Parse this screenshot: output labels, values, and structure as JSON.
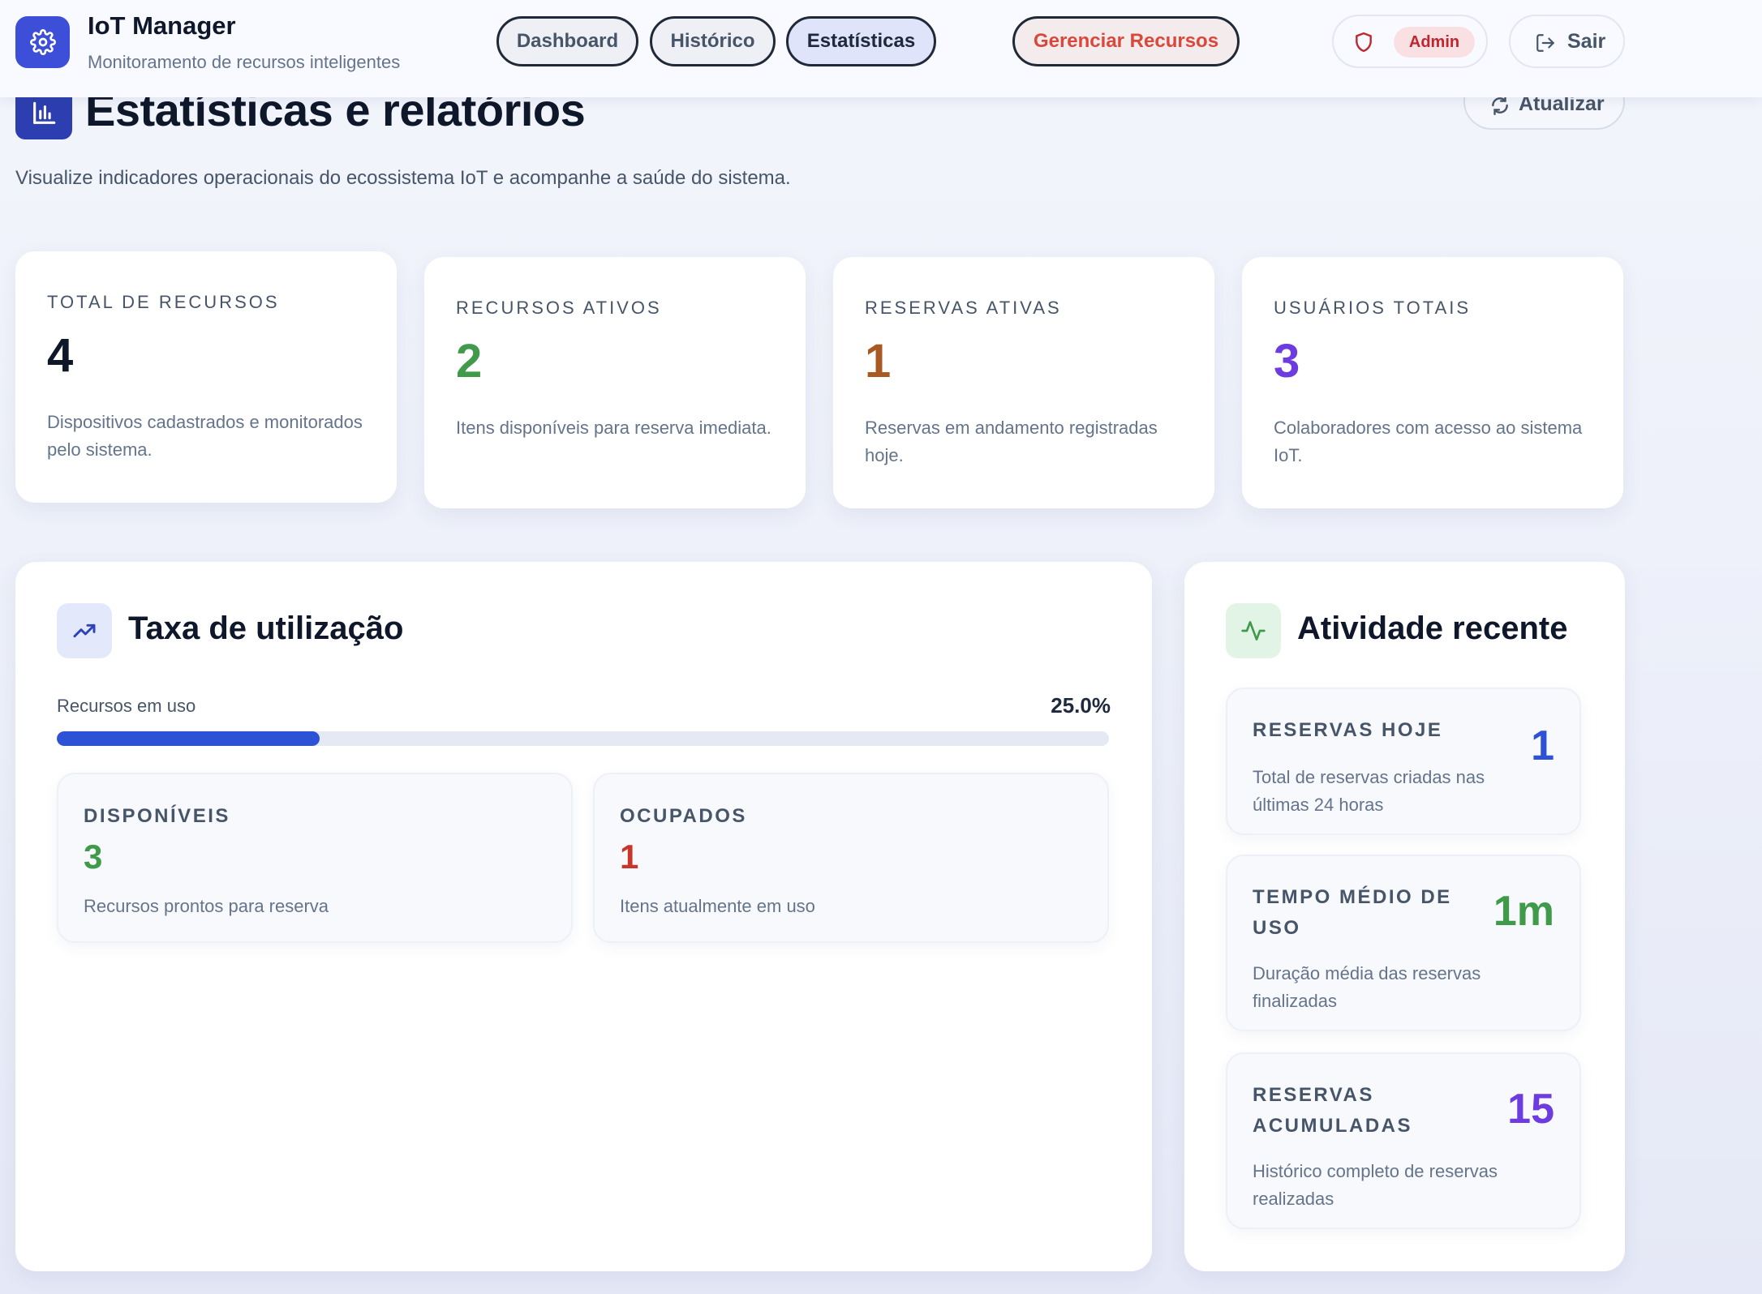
{
  "header": {
    "app_title": "IoT Manager",
    "app_subtitle": "Monitoramento de recursos inteligentes",
    "nav": {
      "dashboard": "Dashboard",
      "historico": "Histórico",
      "estatisticas": "Estatísticas",
      "gerenciar": "Gerenciar Recursos"
    },
    "role_badge": "Admin",
    "logout_label": "Sair"
  },
  "page": {
    "title": "Estatísticas e relatórios",
    "refresh_label": "Atualizar",
    "description": "Visualize indicadores operacionais do ecossistema IoT e acompanhe a saúde do sistema."
  },
  "stats": [
    {
      "label": "TOTAL DE RECURSOS",
      "value": "4",
      "desc": "Dispositivos cadastrados e monitorados pelo sistema.",
      "color": "#0f172a"
    },
    {
      "label": "RECURSOS ATIVOS",
      "value": "2",
      "desc": "Itens disponíveis para reserva imediata.",
      "color": "#3f9a4a"
    },
    {
      "label": "RESERVAS ATIVAS",
      "value": "1",
      "desc": "Reservas em andamento registradas hoje.",
      "color": "#a85a22"
    },
    {
      "label": "USUÁRIOS TOTAIS",
      "value": "3",
      "desc": "Colaboradores com acesso ao sistema IoT.",
      "color": "#6d3ce0"
    }
  ],
  "utilization": {
    "title": "Taxa de utilização",
    "progress_label": "Recursos em uso",
    "progress_text": "25.0%",
    "progress_fraction": 0.25,
    "available": {
      "label": "DISPONÍVEIS",
      "value": "3",
      "desc": "Recursos prontos para reserva",
      "color": "#3f9a4a"
    },
    "occupied": {
      "label": "OCUPADOS",
      "value": "1",
      "desc": "Itens atualmente em uso",
      "color": "#c8352b"
    }
  },
  "activity": {
    "title": "Atividade recente",
    "items": [
      {
        "label": "RESERVAS HOJE",
        "value": "1",
        "desc": "Total de reservas criadas nas últimas 24 horas",
        "color": "#2d52d6"
      },
      {
        "label": "TEMPO MÉDIO DE USO",
        "value": "1m",
        "desc": "Duração média das reservas finalizadas",
        "color": "#3f9a4a"
      },
      {
        "label": "RESERVAS ACUMULADAS",
        "value": "15",
        "desc": "Histórico completo de reservas realizadas",
        "color": "#6d3ce0"
      }
    ]
  },
  "colors": {
    "accent": "#3d4fd9",
    "danger": "#d9483b",
    "progress": "#2d52d6"
  }
}
